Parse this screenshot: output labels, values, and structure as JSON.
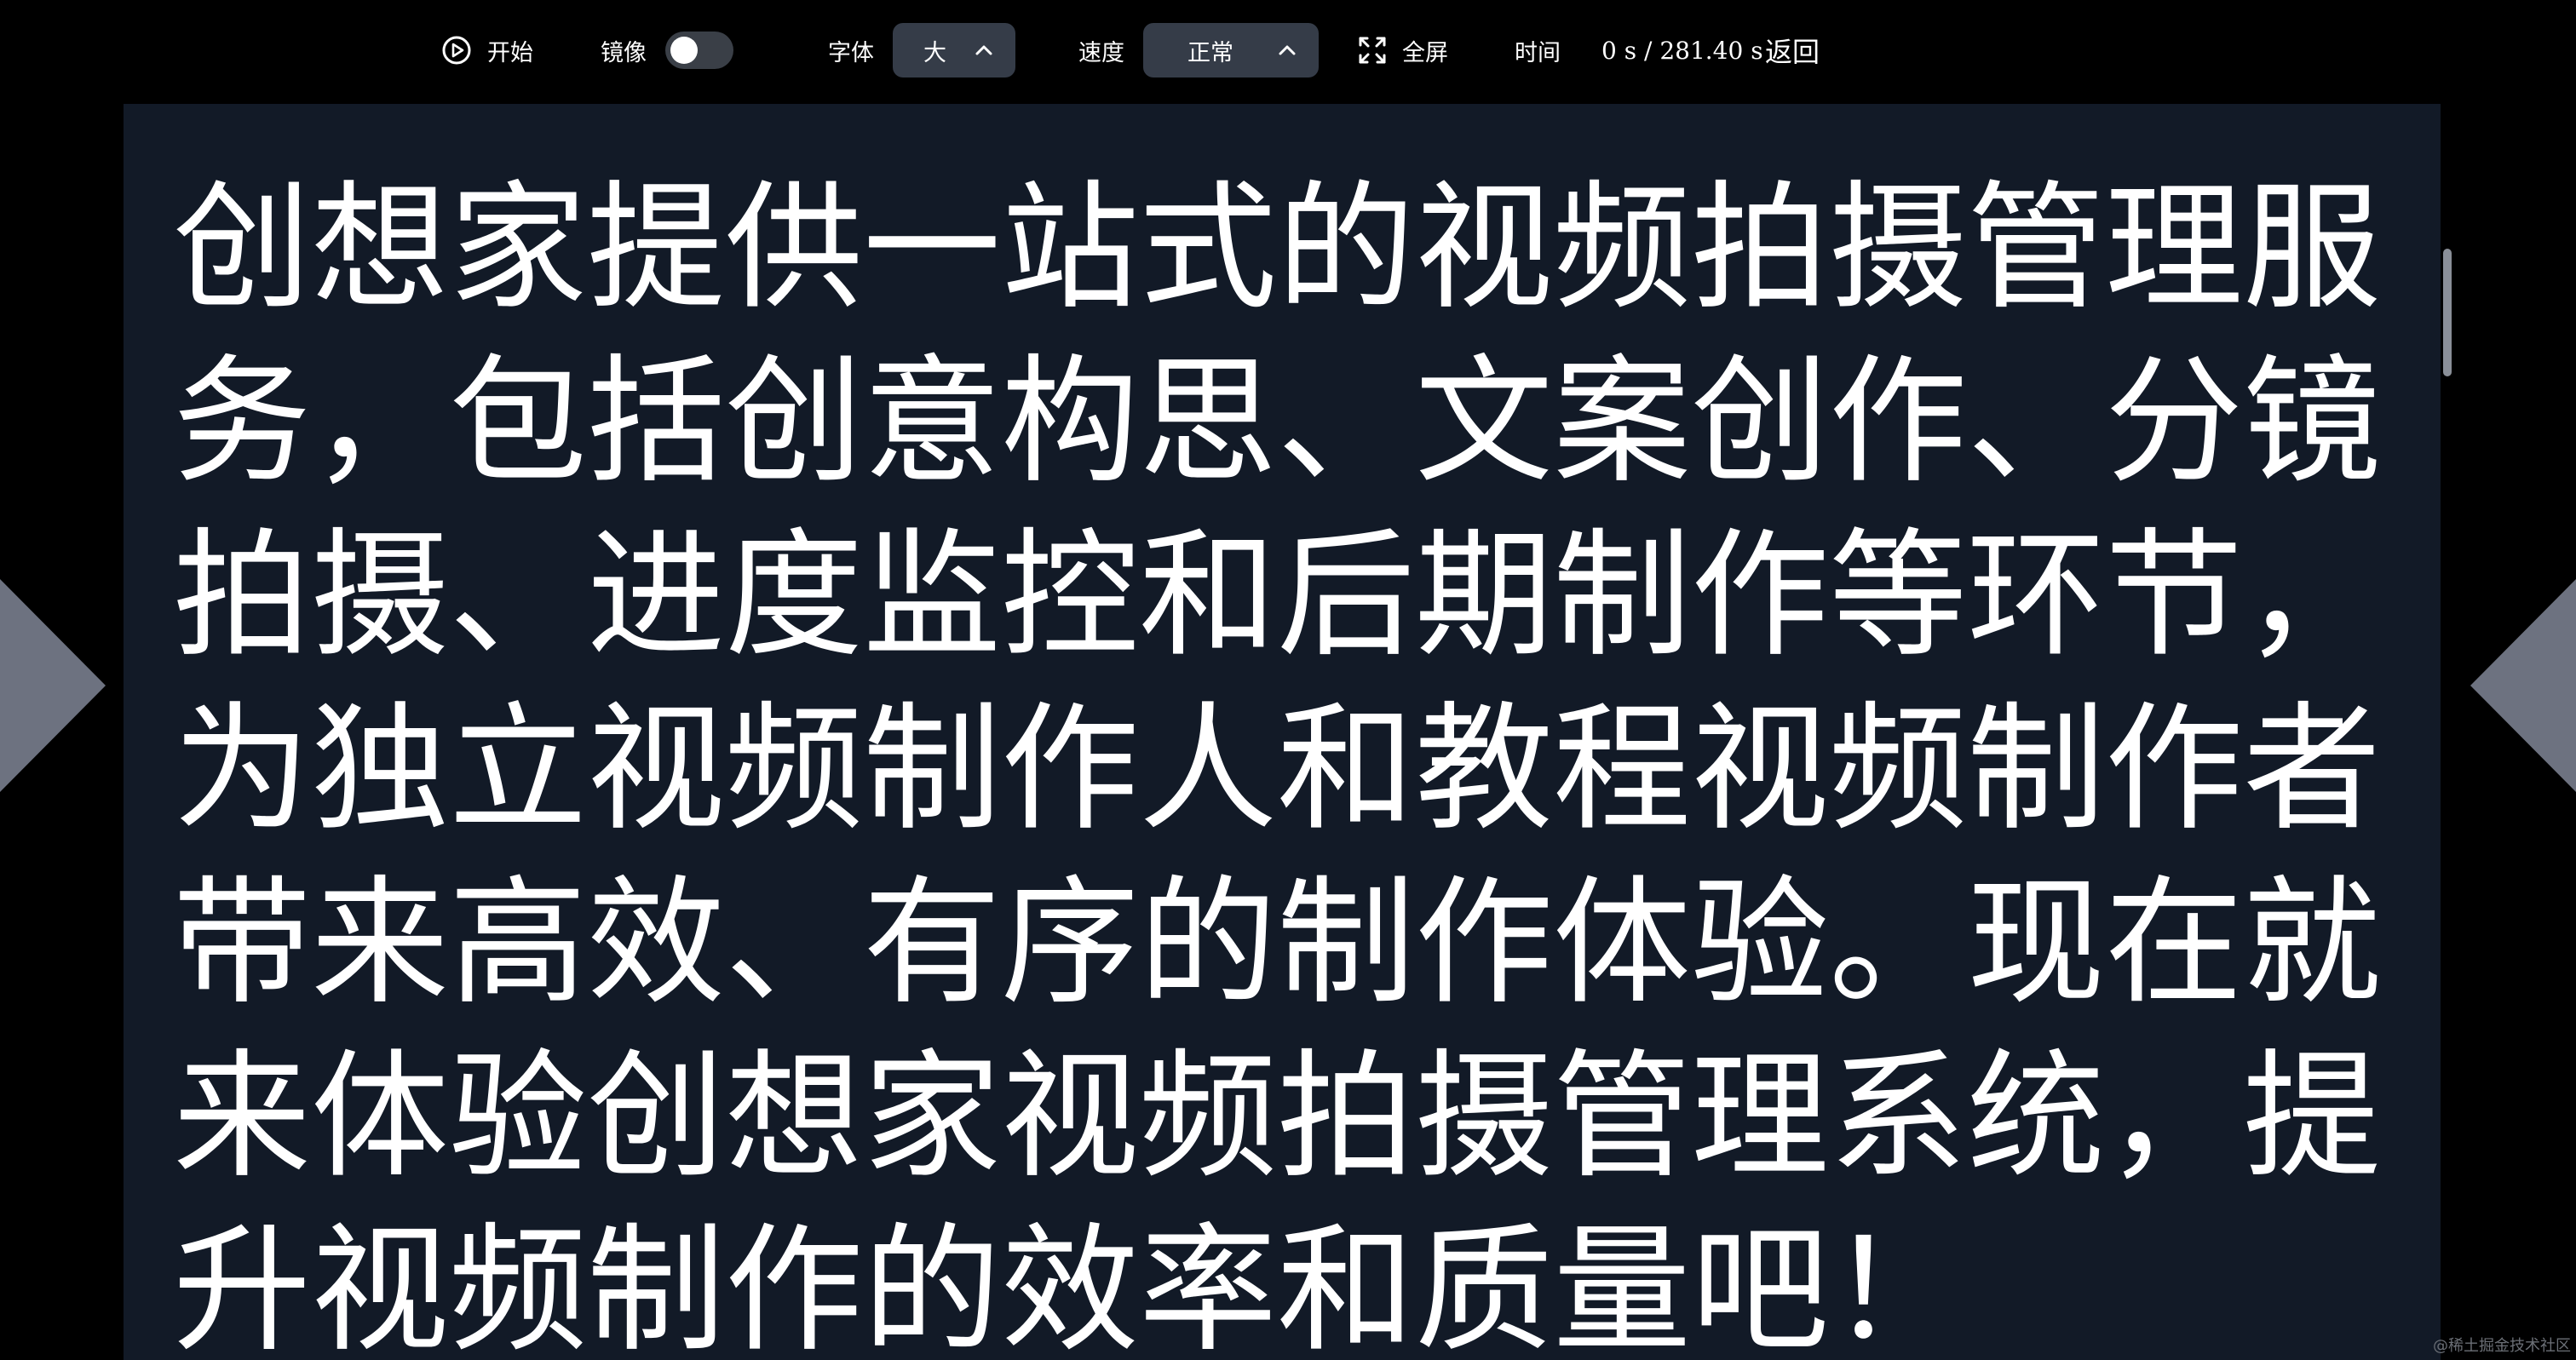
{
  "toolbar": {
    "start_label": "开始",
    "mirror_label": "镜像",
    "mirror_on": false,
    "font_label": "字体",
    "font_value": "大",
    "speed_label": "速度",
    "speed_value": "正常",
    "fullscreen_label": "全屏",
    "time_label": "时间",
    "time_value": "0 s / 281.40 s",
    "back_label": "返回"
  },
  "script": {
    "text": "创想家提供一站式的视频拍摄管理服务，包括创意构思、文案创作、分镜拍摄、进度监控和后期制作等环节，为独立视频制作人和教程视频制作者带来高效、有序的制作体验。现在就来体验创想家视频拍摄管理系统，提升视频制作的效率和质量吧！"
  },
  "icons": {
    "start": "play-circle-icon",
    "fullscreen": "expand-icon",
    "select": "chevron-up-icon",
    "prev": "left-arrow-icon",
    "next": "right-arrow-icon"
  },
  "colors": {
    "background": "#000000",
    "panel": "#121a27",
    "select_bg": "#353c48",
    "toggle_bg": "#3a3f47",
    "text": "#ffffff",
    "nav_arrow": "#6d7280"
  },
  "watermark": "@稀土掘金技术社区"
}
